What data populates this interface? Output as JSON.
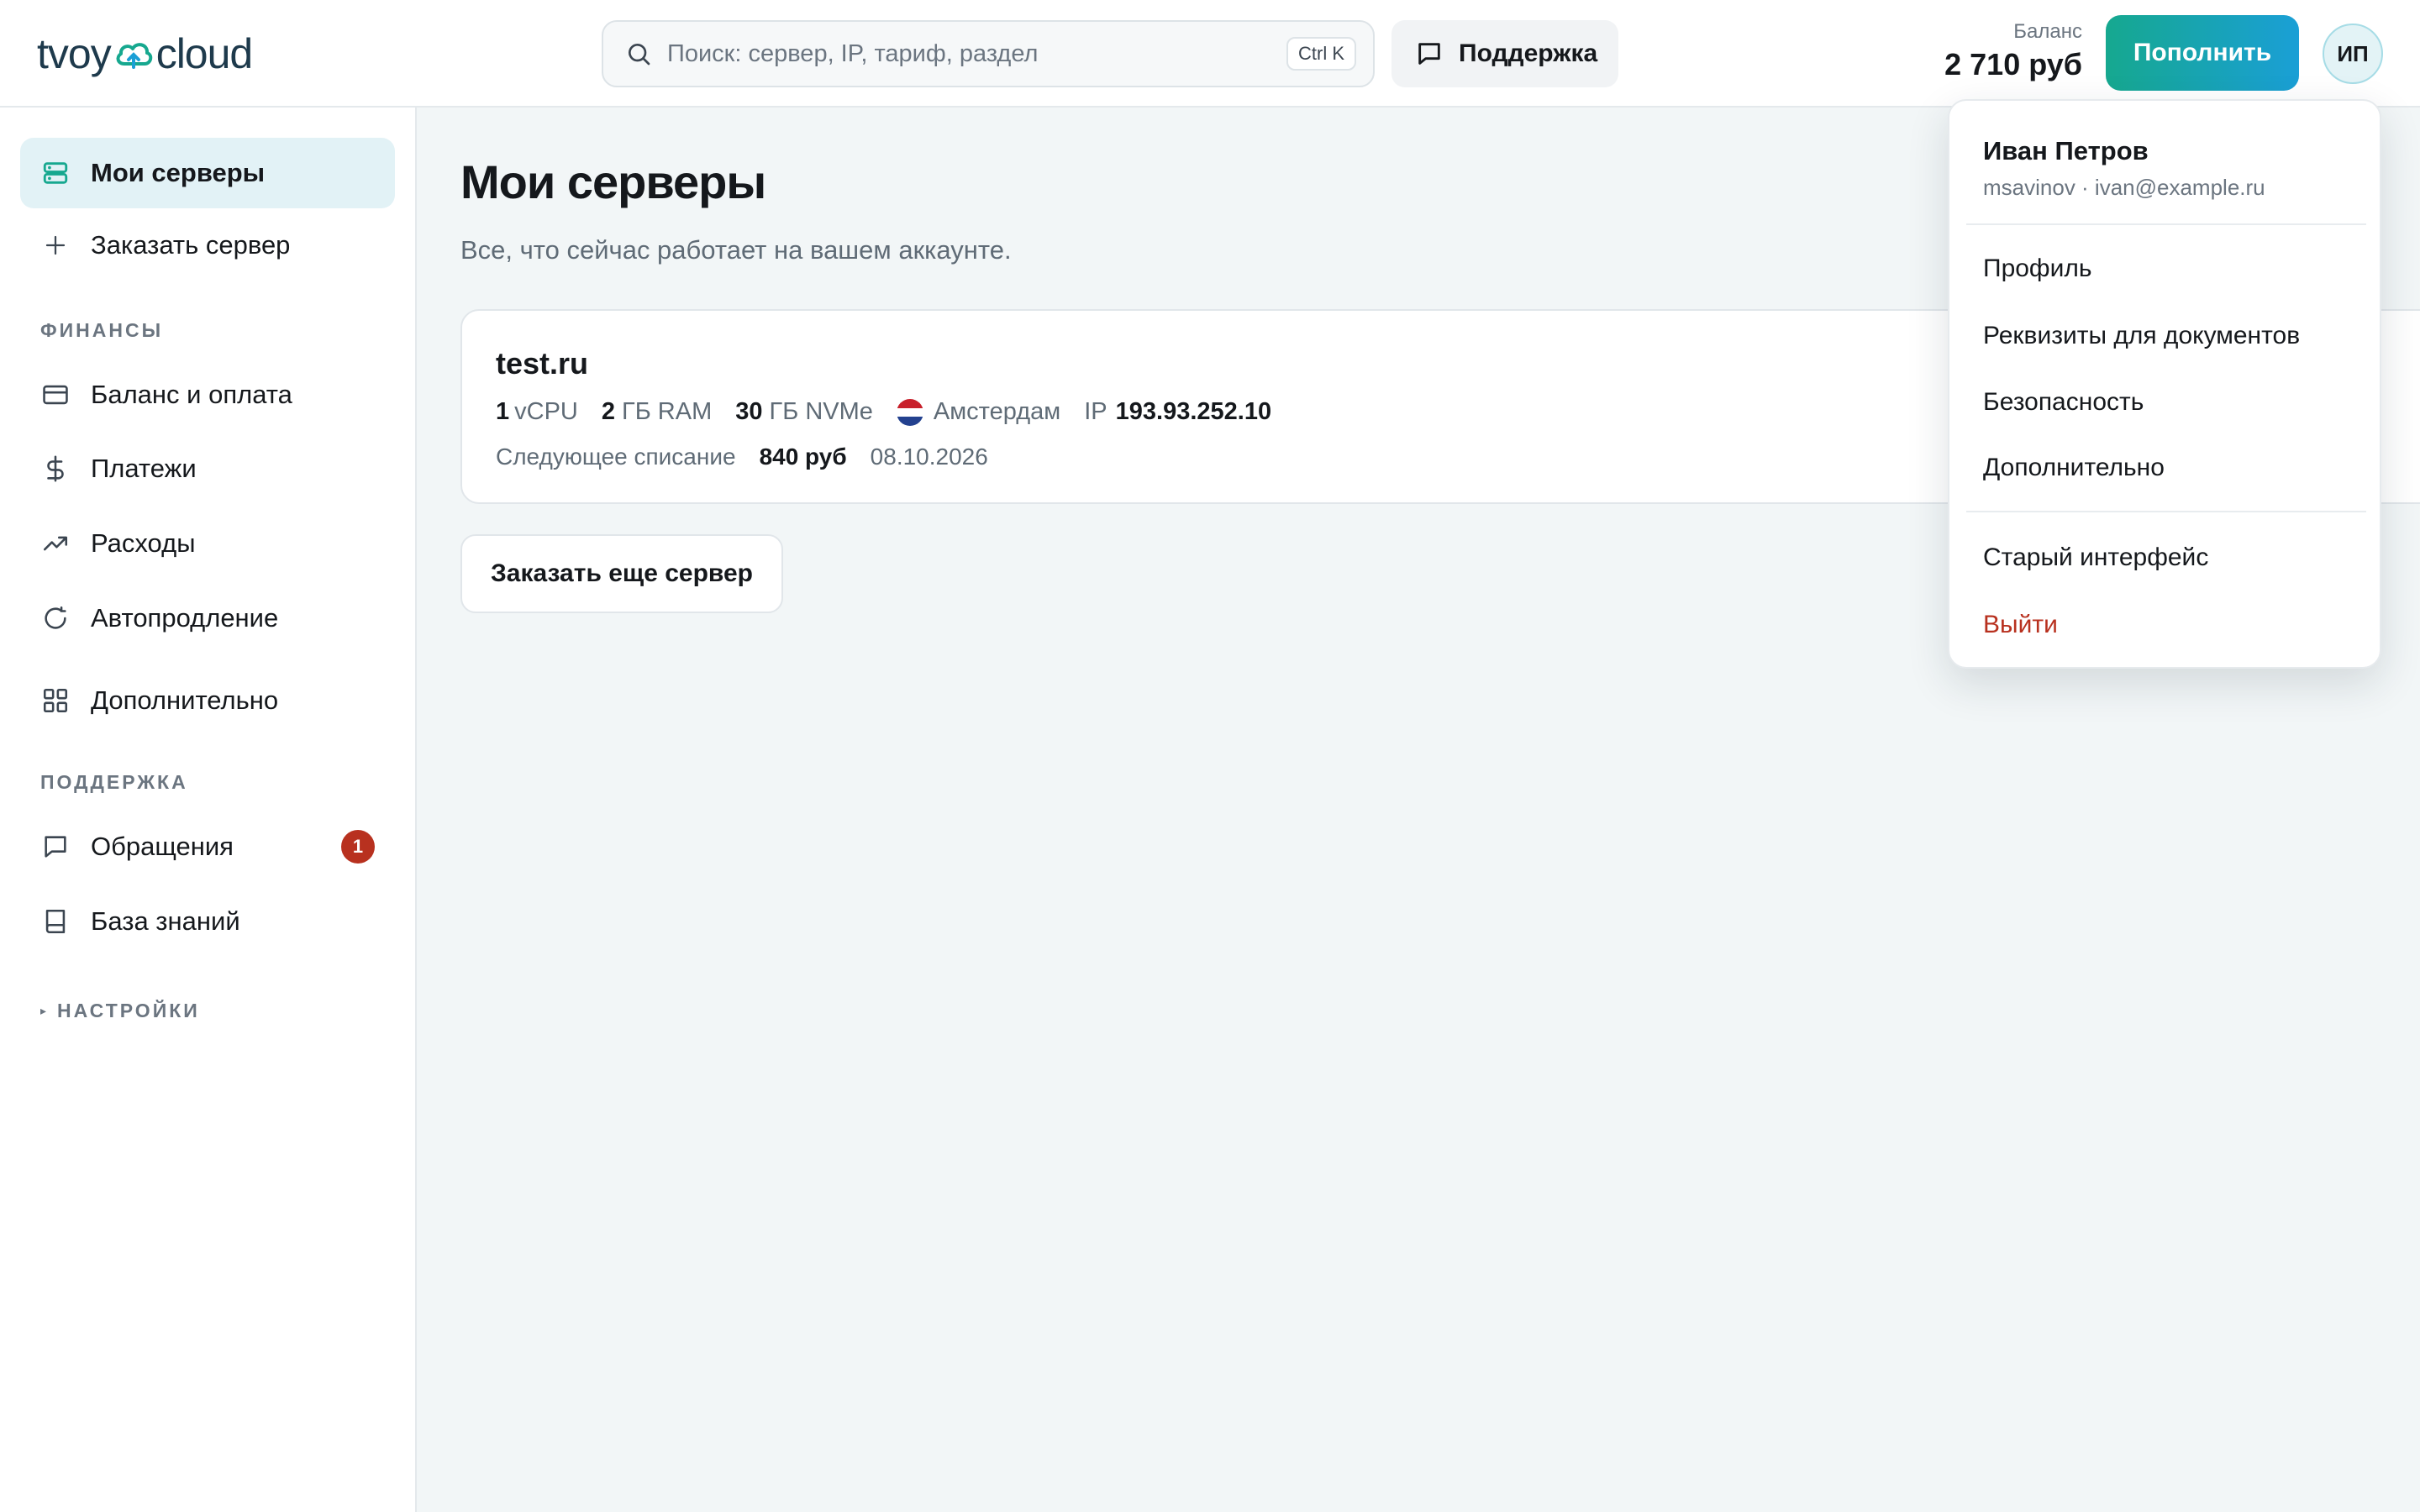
{
  "header": {
    "logo_left": "tvoy",
    "logo_right": "cloud",
    "search_placeholder": "Поиск: сервер, IP, тариф, раздел",
    "search_shortcut": "Ctrl K",
    "support_label": "Поддержка",
    "balance_caption": "Баланс",
    "balance_amount": "2 710 руб",
    "topup_label": "Пополнить",
    "avatar_initials": "ИП"
  },
  "sidebar": {
    "items": [
      {
        "label": "Мои серверы",
        "icon": "server-icon",
        "active": true
      },
      {
        "label": "Заказать сервер",
        "icon": "plus-icon"
      }
    ],
    "finance_label": "ФИНАНСЫ",
    "finance_items": [
      {
        "label": "Баланс и оплата",
        "icon": "credit-card-icon"
      },
      {
        "label": "Платежи",
        "icon": "dollar-icon"
      },
      {
        "label": "Расходы",
        "icon": "trending-up-icon"
      },
      {
        "label": "Автопродление",
        "icon": "refresh-icon"
      },
      {
        "label": "Дополнительно",
        "icon": "grid-icon"
      }
    ],
    "support_label": "ПОДДЕРЖКА",
    "support_items": [
      {
        "label": "Обращения",
        "icon": "chat-icon",
        "badge": "1"
      },
      {
        "label": "База знаний",
        "icon": "book-icon"
      }
    ],
    "settings_label": "НАСТРОЙКИ",
    "settings_caret": "▸"
  },
  "main": {
    "title": "Мои серверы",
    "subtitle": "Все, что сейчас работает на вашем аккаунте.",
    "server": {
      "name": "test.ru",
      "vcpu_value": "1",
      "vcpu_unit": "vCPU",
      "ram_value": "2",
      "ram_unit": "ГБ RAM",
      "disk_value": "30",
      "disk_unit": "ГБ NVMe",
      "location": "Амстердам",
      "ip_label": "IP",
      "ip": "193.93.252.10",
      "next_charge_label": "Следующее списание",
      "next_charge_amount": "840 руб",
      "next_charge_date": "08.10.2026"
    },
    "order_more_label": "Заказать еще сервер"
  },
  "account_menu": {
    "name": "Иван Петров",
    "meta": "msavinov · ivan@example.ru",
    "items": [
      "Профиль",
      "Реквизиты для документов",
      "Безопасность",
      "Дополнительно"
    ],
    "old_ui": "Старый интерфейс",
    "logout": "Выйти"
  },
  "colors": {
    "accent_start": "#16a88f",
    "accent_end": "#1a9fd6",
    "active_bg": "#e2f2f6",
    "danger": "#b8311f"
  }
}
